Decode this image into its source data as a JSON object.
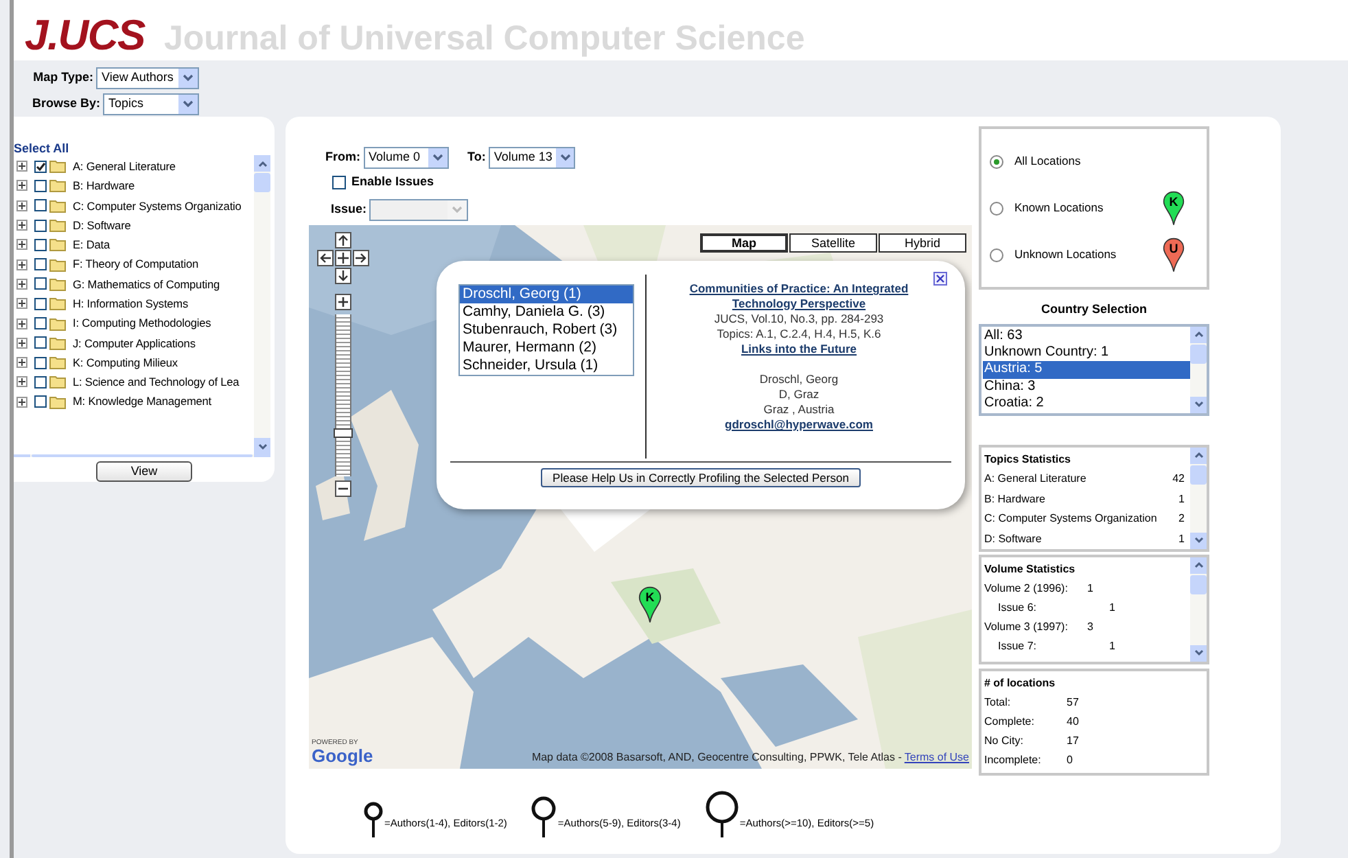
{
  "header": {
    "logo": "J.UCS",
    "title": "Journal of Universal Computer Science"
  },
  "filters": [
    {
      "label": "Map Type:",
      "value": "View Authors"
    },
    {
      "label": "Browse By:",
      "value": "Topics"
    }
  ],
  "topic_tree": {
    "select_all": "Select All",
    "items": [
      {
        "label": "A: General Literature",
        "checked": true
      },
      {
        "label": "B: Hardware",
        "checked": false
      },
      {
        "label": "C: Computer Systems Organizatio",
        "checked": false
      },
      {
        "label": "D: Software",
        "checked": false
      },
      {
        "label": "E: Data",
        "checked": false
      },
      {
        "label": "F: Theory of Computation",
        "checked": false
      },
      {
        "label": "G: Mathematics of Computing",
        "checked": false
      },
      {
        "label": "H: Information Systems",
        "checked": false
      },
      {
        "label": "I: Computing Methodologies",
        "checked": false
      },
      {
        "label": "J: Computer Applications",
        "checked": false
      },
      {
        "label": "K: Computing Milieux",
        "checked": false
      },
      {
        "label": "L: Science and Technology of Lea",
        "checked": false
      },
      {
        "label": "M: Knowledge Management",
        "checked": false
      }
    ],
    "button": "View"
  },
  "volume_filter": {
    "from_label": "From:",
    "from": "Volume 0",
    "to_label": "To:",
    "to": "Volume 13",
    "enable_issues": {
      "label": "Enable Issues",
      "checked": false
    },
    "issue_label": "Issue:",
    "issue_disabled": true
  },
  "map": {
    "types": [
      {
        "label": "Map",
        "selected": true
      },
      {
        "label": "Satellite",
        "selected": false
      },
      {
        "label": "Hybrid",
        "selected": false
      }
    ],
    "zoom": {
      "level": 0.25
    },
    "marker": {
      "letter": "K"
    },
    "attribution": "Map data ©2008 Basarsoft, AND, Geocentre Consulting, PPWK, Tele Atlas -",
    "terms_link": "Terms of Use",
    "powered_by": "POWERED BY",
    "google_logo": "Google",
    "popup": {
      "authors": [
        {
          "label": "Droschl, Georg (1)",
          "selected": true
        },
        {
          "label": "Camhy, Daniela G. (3)",
          "selected": false
        },
        {
          "label": "Stubenrauch, Robert (3)",
          "selected": false
        },
        {
          "label": "Maurer, Hermann (2)",
          "selected": false
        },
        {
          "label": "Schneider, Ursula (1)",
          "selected": false
        }
      ],
      "paper_title": "Communities of Practice: An Integrated Technology Perspective",
      "citation": "JUCS, Vol.10, No.3, pp. 284-293",
      "topics": "Topics: A.1, C.2.4, H.4, H.5, K.6",
      "link": "Links into the Future",
      "person": [
        "Droschl, Georg",
        "D, Graz",
        "Graz , Austria"
      ],
      "email": "gdroschl@hyperwave.com",
      "button": "Please Help Us in Correctly Profiling the Selected Person"
    }
  },
  "legend": [
    {
      "kind": "small",
      "text": "=Authors(1-4), Editors(1-2)"
    },
    {
      "kind": "medium",
      "text": "=Authors(5-9), Editors(3-4)"
    },
    {
      "kind": "large",
      "text": "=Authors(>=10), Editors(>=5)"
    }
  ],
  "location_filter": [
    {
      "label": "All Locations",
      "selected": true
    },
    {
      "label": "Known Locations",
      "selected": false,
      "pin": {
        "letter": "K",
        "color": "#22dd55"
      }
    },
    {
      "label": "Unknown Locations",
      "selected": false,
      "pin": {
        "letter": "U",
        "color": "#ee6a55"
      }
    }
  ],
  "country_selection": {
    "title": "Country Selection",
    "options": [
      {
        "label": "All: 63",
        "selected": false
      },
      {
        "label": "Unknown Country: 1",
        "selected": false
      },
      {
        "label": "Austria: 5",
        "selected": true
      },
      {
        "label": "China: 3",
        "selected": false
      },
      {
        "label": "Croatia: 2",
        "selected": false
      }
    ]
  },
  "topics_statistics": {
    "title": "Topics Statistics",
    "rows": [
      {
        "label": "A: General Literature",
        "value": "42"
      },
      {
        "label": "B: Hardware",
        "value": "1"
      },
      {
        "label": "C: Computer Systems Organization",
        "value": "2"
      },
      {
        "label": "D: Software",
        "value": "1"
      }
    ]
  },
  "volume_statistics": {
    "title": "Volume Statistics",
    "rows": [
      {
        "kind": "volume",
        "label": "Volume 2 (1996):",
        "value": "1"
      },
      {
        "kind": "issue",
        "label": "Issue 6:",
        "value": "1"
      },
      {
        "kind": "volume",
        "label": "Volume 3 (1997):",
        "value": "3"
      },
      {
        "kind": "issue",
        "label": "Issue 7:",
        "value": "1"
      }
    ]
  },
  "locations": {
    "title": "# of locations",
    "rows": [
      {
        "label": "Total:",
        "value": "57"
      },
      {
        "label": "Complete:",
        "value": "40"
      },
      {
        "label": "No City:",
        "value": "17"
      },
      {
        "label": "Incomplete:",
        "value": "0"
      }
    ]
  }
}
